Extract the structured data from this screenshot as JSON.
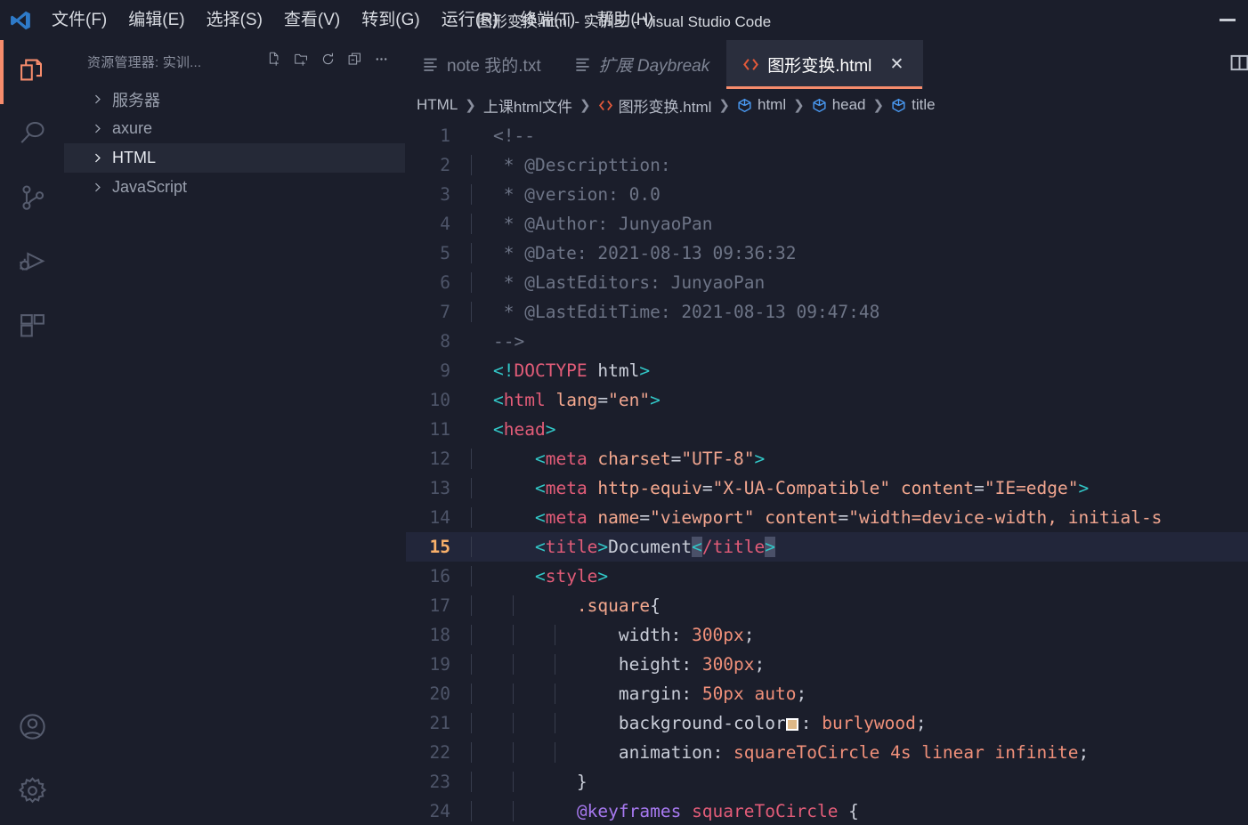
{
  "window": {
    "title": "图形变换.html - 实训三 - Visual Studio Code",
    "minimize_label": "minimize"
  },
  "menubar": {
    "items": [
      {
        "label": "文件(F)",
        "name": "menu-file"
      },
      {
        "label": "编辑(E)",
        "name": "menu-edit"
      },
      {
        "label": "选择(S)",
        "name": "menu-selection"
      },
      {
        "label": "查看(V)",
        "name": "menu-view"
      },
      {
        "label": "转到(G)",
        "name": "menu-go"
      },
      {
        "label": "运行(R)",
        "name": "menu-run"
      },
      {
        "label": "终端(T)",
        "name": "menu-terminal"
      },
      {
        "label": "帮助(H)",
        "name": "menu-help"
      }
    ]
  },
  "activitybar": {
    "items": [
      {
        "icon": "explorer-icon",
        "active": true
      },
      {
        "icon": "search-icon",
        "active": false
      },
      {
        "icon": "source-control-icon",
        "active": false
      },
      {
        "icon": "run-and-debug-icon",
        "active": false
      },
      {
        "icon": "extensions-icon",
        "active": false
      }
    ],
    "bottom_items": [
      {
        "icon": "account-icon"
      },
      {
        "icon": "settings-gear-icon"
      }
    ],
    "active_color": "#f78c6c"
  },
  "sidebar": {
    "title": "资源管理器: 实训...",
    "actions": [
      {
        "icon": "new-file-icon",
        "label": "新建文件"
      },
      {
        "icon": "new-folder-icon",
        "label": "新建文件夹"
      },
      {
        "icon": "refresh-icon",
        "label": "刷新资源管理器"
      },
      {
        "icon": "collapse-all-icon",
        "label": "在资源管理器中折叠文件夹"
      },
      {
        "icon": "more-actions-icon",
        "label": "视图和更多操作..."
      }
    ],
    "tree": [
      {
        "label": "服务器",
        "selected": false
      },
      {
        "label": "axure",
        "selected": false
      },
      {
        "label": "HTML",
        "selected": true
      },
      {
        "label": "JavaScript",
        "selected": false
      }
    ]
  },
  "tabs": [
    {
      "label": "note 我的.txt",
      "icon": "text-file-icon",
      "active": false,
      "preview": false,
      "closable": false
    },
    {
      "label": "扩展 Daybreak",
      "icon": "text-file-icon",
      "active": false,
      "preview": true,
      "closable": false
    },
    {
      "label": "图形变换.html",
      "icon": "html-file-icon",
      "active": true,
      "preview": false,
      "closable": true,
      "close_glyph": "✕"
    }
  ],
  "tabbar_right": {
    "split_editor_icon": "split-editor-icon"
  },
  "breadcrumbs": [
    {
      "label": "HTML",
      "icon": null
    },
    {
      "label": "上课html文件",
      "icon": null
    },
    {
      "label": "图形变换.html",
      "icon": "html-file-icon"
    },
    {
      "label": "html",
      "icon": "symbol-field-icon"
    },
    {
      "label": "head",
      "icon": "symbol-field-icon"
    },
    {
      "label": "title",
      "icon": "symbol-field-icon"
    }
  ],
  "breadcrumb_separator": "❯",
  "editor": {
    "active_line": 15,
    "cursor_color": "#f9b06a",
    "code": [
      {
        "n": 1,
        "indent": 0,
        "tokens": [
          {
            "c": "t-comment",
            "t": "<!--"
          }
        ]
      },
      {
        "n": 2,
        "indent": 1,
        "tokens": [
          {
            "c": "t-comment",
            "t": " * @Descripttion: "
          }
        ]
      },
      {
        "n": 3,
        "indent": 1,
        "tokens": [
          {
            "c": "t-comment",
            "t": " * @version: 0.0"
          }
        ]
      },
      {
        "n": 4,
        "indent": 1,
        "tokens": [
          {
            "c": "t-comment",
            "t": " * @Author: JunyaoPan"
          }
        ]
      },
      {
        "n": 5,
        "indent": 1,
        "tokens": [
          {
            "c": "t-comment",
            "t": " * @Date: 2021-08-13 09:36:32"
          }
        ]
      },
      {
        "n": 6,
        "indent": 1,
        "tokens": [
          {
            "c": "t-comment",
            "t": " * @LastEditors: JunyaoPan"
          }
        ]
      },
      {
        "n": 7,
        "indent": 1,
        "tokens": [
          {
            "c": "t-comment",
            "t": " * @LastEditTime: 2021-08-13 09:47:48"
          }
        ]
      },
      {
        "n": 8,
        "indent": 0,
        "tokens": [
          {
            "c": "t-comment",
            "t": "-->"
          }
        ]
      },
      {
        "n": 9,
        "indent": 0,
        "tokens": [
          {
            "c": "t-bracket",
            "t": "<!"
          },
          {
            "c": "t-tag",
            "t": "DOCTYPE"
          },
          {
            "c": "t-text",
            "t": " html"
          },
          {
            "c": "t-bracket",
            "t": ">"
          }
        ]
      },
      {
        "n": 10,
        "indent": 0,
        "tokens": [
          {
            "c": "t-bracket",
            "t": "<"
          },
          {
            "c": "t-tag",
            "t": "html"
          },
          {
            "c": "t-attr",
            "t": " lang"
          },
          {
            "c": "t-punct",
            "t": "="
          },
          {
            "c": "t-string",
            "t": "\"en\""
          },
          {
            "c": "t-bracket",
            "t": ">"
          }
        ]
      },
      {
        "n": 11,
        "indent": 0,
        "tokens": [
          {
            "c": "t-bracket",
            "t": "<"
          },
          {
            "c": "t-tag",
            "t": "head"
          },
          {
            "c": "t-bracket",
            "t": ">"
          }
        ]
      },
      {
        "n": 12,
        "indent": 1,
        "tokens": [
          {
            "c": "t-text",
            "t": "    "
          },
          {
            "c": "t-bracket",
            "t": "<"
          },
          {
            "c": "t-tag",
            "t": "meta"
          },
          {
            "c": "t-attr",
            "t": " charset"
          },
          {
            "c": "t-punct",
            "t": "="
          },
          {
            "c": "t-string",
            "t": "\"UTF-8\""
          },
          {
            "c": "t-bracket",
            "t": ">"
          }
        ]
      },
      {
        "n": 13,
        "indent": 1,
        "tokens": [
          {
            "c": "t-text",
            "t": "    "
          },
          {
            "c": "t-bracket",
            "t": "<"
          },
          {
            "c": "t-tag",
            "t": "meta"
          },
          {
            "c": "t-attr",
            "t": " http-equiv"
          },
          {
            "c": "t-punct",
            "t": "="
          },
          {
            "c": "t-string",
            "t": "\"X-UA-Compatible\""
          },
          {
            "c": "t-attr",
            "t": " content"
          },
          {
            "c": "t-punct",
            "t": "="
          },
          {
            "c": "t-string",
            "t": "\"IE=edge\""
          },
          {
            "c": "t-bracket",
            "t": ">"
          }
        ]
      },
      {
        "n": 14,
        "indent": 1,
        "tokens": [
          {
            "c": "t-text",
            "t": "    "
          },
          {
            "c": "t-bracket",
            "t": "<"
          },
          {
            "c": "t-tag",
            "t": "meta"
          },
          {
            "c": "t-attr",
            "t": " name"
          },
          {
            "c": "t-punct",
            "t": "="
          },
          {
            "c": "t-string",
            "t": "\"viewport\""
          },
          {
            "c": "t-attr",
            "t": " content"
          },
          {
            "c": "t-punct",
            "t": "="
          },
          {
            "c": "t-string",
            "t": "\"width=device-width, initial-s"
          }
        ]
      },
      {
        "n": 15,
        "indent": 1,
        "tokens": [
          {
            "c": "t-text",
            "t": "    "
          },
          {
            "c": "t-bracket",
            "t": "<"
          },
          {
            "c": "t-tag",
            "t": "title"
          },
          {
            "c": "t-bracket",
            "t": ">"
          },
          {
            "c": "t-text",
            "t": "Document"
          },
          {
            "c": "t-bracket bracket-match",
            "t": "<"
          },
          {
            "c": "t-tag",
            "t": "/title"
          },
          {
            "c": "t-bracket bracket-match",
            "t": ">"
          }
        ]
      },
      {
        "n": 16,
        "indent": 1,
        "tokens": [
          {
            "c": "t-text",
            "t": "    "
          },
          {
            "c": "t-bracket",
            "t": "<"
          },
          {
            "c": "t-tag",
            "t": "style"
          },
          {
            "c": "t-bracket",
            "t": ">"
          }
        ]
      },
      {
        "n": 17,
        "indent": 2,
        "tokens": [
          {
            "c": "t-text",
            "t": "        "
          },
          {
            "c": "t-sel",
            "t": ".square"
          },
          {
            "c": "t-punct",
            "t": "{"
          }
        ]
      },
      {
        "n": 18,
        "indent": 3,
        "tokens": [
          {
            "c": "t-text",
            "t": "            "
          },
          {
            "c": "t-prop",
            "t": "width"
          },
          {
            "c": "t-punct",
            "t": ": "
          },
          {
            "c": "t-val",
            "t": "300px"
          },
          {
            "c": "t-punct",
            "t": ";"
          }
        ]
      },
      {
        "n": 19,
        "indent": 3,
        "tokens": [
          {
            "c": "t-text",
            "t": "            "
          },
          {
            "c": "t-prop",
            "t": "height"
          },
          {
            "c": "t-punct",
            "t": ": "
          },
          {
            "c": "t-val",
            "t": "300px"
          },
          {
            "c": "t-punct",
            "t": ";"
          }
        ]
      },
      {
        "n": 20,
        "indent": 3,
        "tokens": [
          {
            "c": "t-text",
            "t": "            "
          },
          {
            "c": "t-prop",
            "t": "margin"
          },
          {
            "c": "t-punct",
            "t": ": "
          },
          {
            "c": "t-val",
            "t": "50px auto"
          },
          {
            "c": "t-punct",
            "t": ";"
          }
        ]
      },
      {
        "n": 21,
        "indent": 3,
        "swatch_after": 2,
        "tokens": [
          {
            "c": "t-text",
            "t": "            "
          },
          {
            "c": "t-prop",
            "t": "background-color"
          },
          {
            "c": "t-punct",
            "t": ": "
          },
          {
            "c": "t-val",
            "t": "burlywood"
          },
          {
            "c": "t-punct",
            "t": ";"
          }
        ]
      },
      {
        "n": 22,
        "indent": 3,
        "tokens": [
          {
            "c": "t-text",
            "t": "            "
          },
          {
            "c": "t-prop",
            "t": "animation"
          },
          {
            "c": "t-punct",
            "t": ": "
          },
          {
            "c": "t-val",
            "t": "squareToCircle "
          },
          {
            "c": "t-num",
            "t": "4s"
          },
          {
            "c": "t-val",
            "t": " linear infinite"
          },
          {
            "c": "t-punct",
            "t": ";"
          }
        ]
      },
      {
        "n": 23,
        "indent": 2,
        "tokens": [
          {
            "c": "t-text",
            "t": "        "
          },
          {
            "c": "t-punct",
            "t": "}"
          }
        ]
      },
      {
        "n": 24,
        "indent": 2,
        "tokens": [
          {
            "c": "t-text",
            "t": "        "
          },
          {
            "c": "t-at",
            "t": "@keyframes"
          },
          {
            "c": "t-name",
            "t": " squareToCircle"
          },
          {
            "c": "t-punct",
            "t": " {"
          }
        ]
      }
    ],
    "swatch_color": "#DEB887"
  }
}
